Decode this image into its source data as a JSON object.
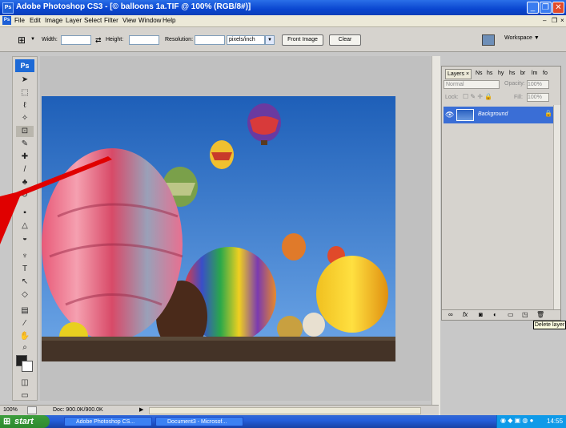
{
  "window": {
    "title": "Adobe Photoshop CS3 - [© balloons 1a.TIF @ 100% (RGB/8#)]",
    "app_icon_label": "Ps",
    "controls": [
      "_",
      "❐",
      "✕"
    ],
    "doc_controls": [
      "–",
      "❐",
      "×"
    ]
  },
  "menu": {
    "items": [
      "File",
      "Edit",
      "Image",
      "Layer",
      "Select",
      "Filter",
      "View",
      "Window",
      "Help"
    ]
  },
  "options_bar": {
    "width_label": "Width:",
    "width_value": "",
    "height_label": "Height:",
    "height_value": "",
    "resolution_label": "Resolution:",
    "resolution_value": "",
    "units_value": "pixels/inch",
    "front_image_label": "Front Image",
    "clear_label": "Clear",
    "workspace_label": "Workspace ▼"
  },
  "tools": {
    "logo": "Ps"
  },
  "layers_panel": {
    "tabs": [
      "Layers ×",
      "Ns",
      "hs",
      "hy",
      "hs",
      "br",
      "lm",
      "fo"
    ],
    "blend_mode": "Normal",
    "opacity_label": "Opacity:",
    "opacity_value": "100%",
    "lock_label": "Lock:",
    "fill_label": "Fill:",
    "fill_value": "100%",
    "layer_name": "Background",
    "footer_icons": [
      "link-icon",
      "fx-icon",
      "mask-icon",
      "adjustment-icon",
      "group-icon",
      "new-layer-icon",
      "trash-icon"
    ]
  },
  "tooltip": "Delete layer",
  "status_bar": {
    "zoom": "100%",
    "doc_info": "Doc: 900.0K/900.0K"
  },
  "taskbar": {
    "start_label": "start",
    "buttons": [
      "Adobe Photoshop CS...",
      "Document3 - Microsof..."
    ],
    "clock": "14:55"
  },
  "colors": {
    "title_bar": "#0a46d0",
    "layer_selected": "#3a6ed6",
    "annotation_arrow": "#e00000",
    "start_button": "#2e8a2e"
  }
}
